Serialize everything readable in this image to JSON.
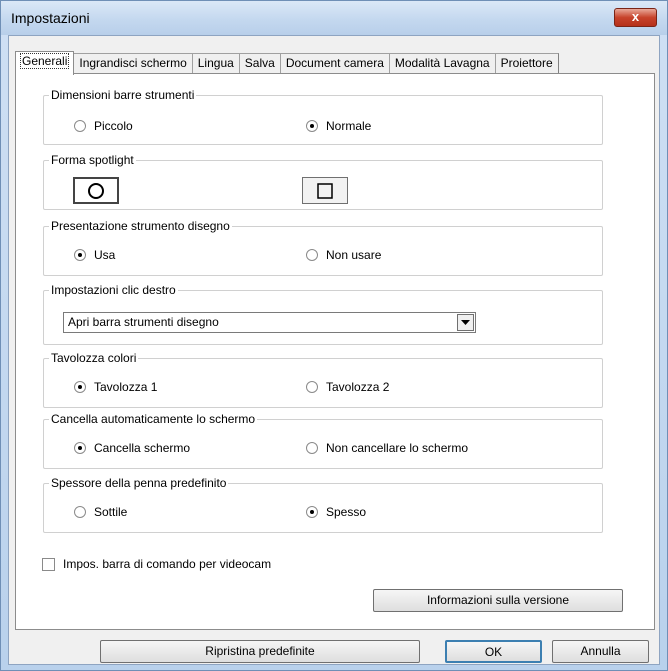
{
  "window": {
    "title": "Impostazioni",
    "close_glyph": "x"
  },
  "tabs": [
    {
      "label": "Generali"
    },
    {
      "label": "Ingrandisci schermo"
    },
    {
      "label": "Lingua"
    },
    {
      "label": "Salva"
    },
    {
      "label": "Document camera"
    },
    {
      "label": "Modalità Lavagna"
    },
    {
      "label": "Proiettore"
    }
  ],
  "groups": {
    "toolbar_size": {
      "label": "Dimensioni barre strumenti",
      "options": [
        "Piccolo",
        "Normale"
      ],
      "selected": "Normale"
    },
    "spotlight": {
      "label": "Forma spotlight",
      "shapes": [
        "circle",
        "square"
      ],
      "selected": "circle"
    },
    "draw_tool": {
      "label": "Presentazione strumento disegno",
      "options": [
        "Usa",
        "Non usare"
      ],
      "selected": "Usa"
    },
    "right_click": {
      "label": "Impostazioni clic destro",
      "value": "Apri barra strumenti disegno"
    },
    "palette": {
      "label": "Tavolozza colori",
      "options": [
        "Tavolozza 1",
        "Tavolozza 2"
      ],
      "selected": "Tavolozza 1"
    },
    "auto_clear": {
      "label": "Cancella automaticamente lo schermo",
      "options": [
        "Cancella schermo",
        "Non cancellare lo schermo"
      ],
      "selected": "Cancella schermo"
    },
    "pen_thickness": {
      "label": "Spessore della penna predefinito",
      "options": [
        "Sottile",
        "Spesso"
      ],
      "selected": "Spesso"
    }
  },
  "webcam_checkbox": {
    "label": "Impos. barra di comando per videocam",
    "checked": false
  },
  "buttons": {
    "version": "Informazioni sulla versione",
    "restore": "Ripristina predefinite",
    "ok": "OK",
    "cancel": "Annulla"
  }
}
